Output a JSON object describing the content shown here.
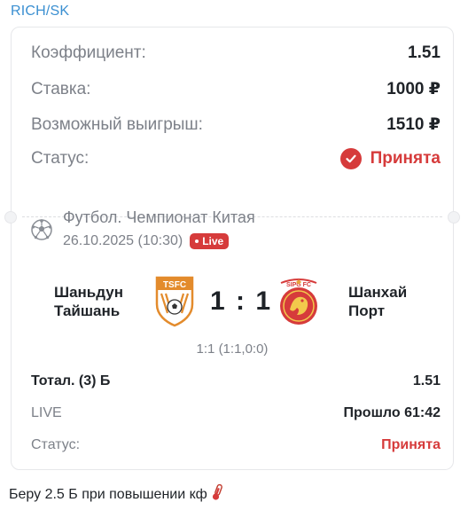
{
  "sender": "RICH/SK",
  "bet": {
    "coef_label": "Коэффициент:",
    "coef_value": "1.51",
    "stake_label": "Ставка:",
    "stake_value": "1000 ₽",
    "payout_label": "Возможный выигрыш:",
    "payout_value": "1510 ₽",
    "status_label": "Статус:",
    "status_value": "Принята"
  },
  "event": {
    "title": "Футбол. Чемпионат Китая",
    "datetime": "26.10.2025 (10:30)",
    "live_badge": "Live",
    "home_line1": "Шаньдун",
    "home_line2": "Тайшань",
    "away_line1": "Шанхай",
    "away_line2": "Порт",
    "home_logo_text": "TSFC",
    "away_logo_text": "SIPG FC",
    "score": "1 : 1",
    "subscore": "1:1 (1:1,0:0)"
  },
  "market": {
    "name": "Тотал. (3) Б",
    "odds": "1.51",
    "mode": "LIVE",
    "elapsed": "Прошло 61:42",
    "status_label": "Статус:",
    "status_value": "Принята"
  },
  "caption": "Беру 2.5 Б при повышении кф",
  "colors": {
    "accent_red": "#d63b3b",
    "sender_blue": "#3a8fd1",
    "muted": "#7d8189"
  }
}
